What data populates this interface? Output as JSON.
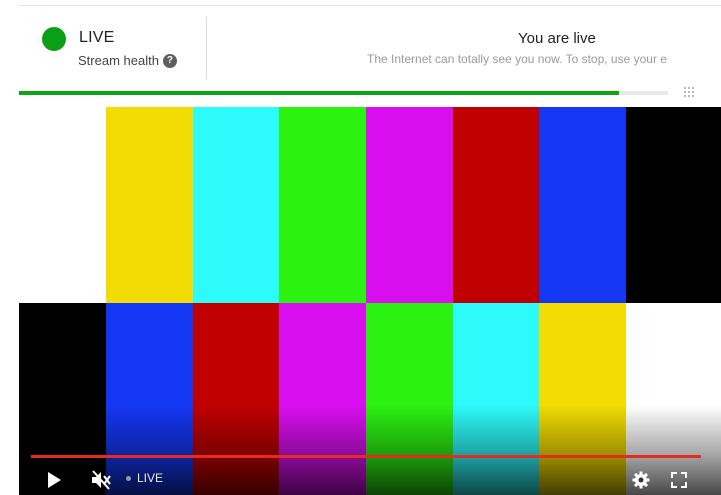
{
  "stream": {
    "status_label": "LIVE",
    "health_label": "Stream health",
    "status_title": "You are live",
    "status_message": "The Internet can totally see you now. To stop, use your e",
    "progress": 0.925,
    "colors": {
      "live_green": "#0b9f17",
      "progress_green": "#0fa418"
    }
  },
  "icons": {
    "help": "help-circle-icon",
    "drag": "drag-handle-icon"
  },
  "player": {
    "live_label": "LIVE",
    "accent": "#e52a1f",
    "controls": [
      "play-icon",
      "mute-icon",
      "settings-icon",
      "fullscreen-icon"
    ],
    "test_pattern": {
      "top_bars": [
        "#ffffff",
        "#f2dc04",
        "#2dfafa",
        "#2bf211",
        "#d90ff0",
        "#c00000",
        "#1437f4",
        "#000000"
      ],
      "bottom_bars": [
        "#000000",
        "#1437f4",
        "#c00000",
        "#d90ff0",
        "#2bf211",
        "#2dfafa",
        "#f2dc04",
        "#ffffff"
      ]
    }
  }
}
